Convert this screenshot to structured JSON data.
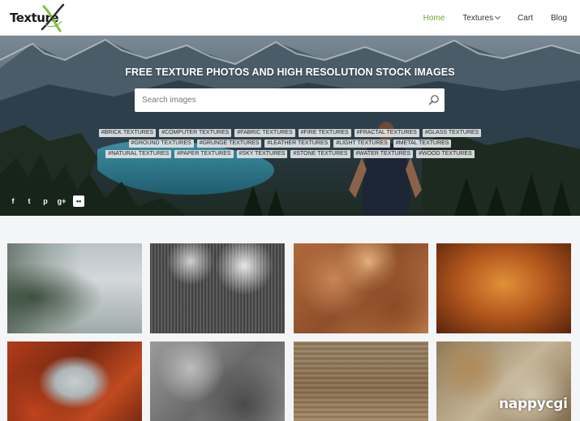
{
  "header": {
    "logo_text": "Texture",
    "nav": [
      {
        "label": "Home",
        "active": true
      },
      {
        "label": "Textures",
        "dropdown": true
      },
      {
        "label": "Cart"
      },
      {
        "label": "Blog"
      }
    ]
  },
  "hero": {
    "title": "FREE TEXTURE PHOTOS AND HIGH RESOLUTION STOCK IMAGES",
    "search_placeholder": "Search images",
    "tags": [
      "#BRICK TEXTURES",
      "#COMPUTER TEXTURES",
      "#FABRIC TEXTURES",
      "#FIRE TEXTURES",
      "#FRACTAL TEXTURES",
      "#GLASS TEXTURES",
      "#GROUND TEXTURES",
      "#GRUNGE TEXTURES",
      "#LEATHER TEXTURES",
      "#LIGHT TEXTURES",
      "#METAL TEXTURES",
      "#NATURAL TEXTURES",
      "#PAPER TEXTURES",
      "#SKY TEXTURES",
      "#STONE TEXTURES",
      "#WATER TEXTURES",
      "#WOOD TEXTURES"
    ],
    "social": [
      {
        "icon": "facebook-icon",
        "glyph": "f"
      },
      {
        "icon": "twitter-icon",
        "glyph": "t"
      },
      {
        "icon": "pinterest-icon",
        "glyph": "p"
      },
      {
        "icon": "google-plus-icon",
        "glyph": "g+"
      },
      {
        "icon": "flickr-icon",
        "glyph": "••"
      }
    ]
  },
  "gallery": {
    "watermark": "nappycgi"
  },
  "colors": {
    "accent": "#6aab2b",
    "header_bg": "#ffffff",
    "page_bg": "#f4f5f6"
  }
}
